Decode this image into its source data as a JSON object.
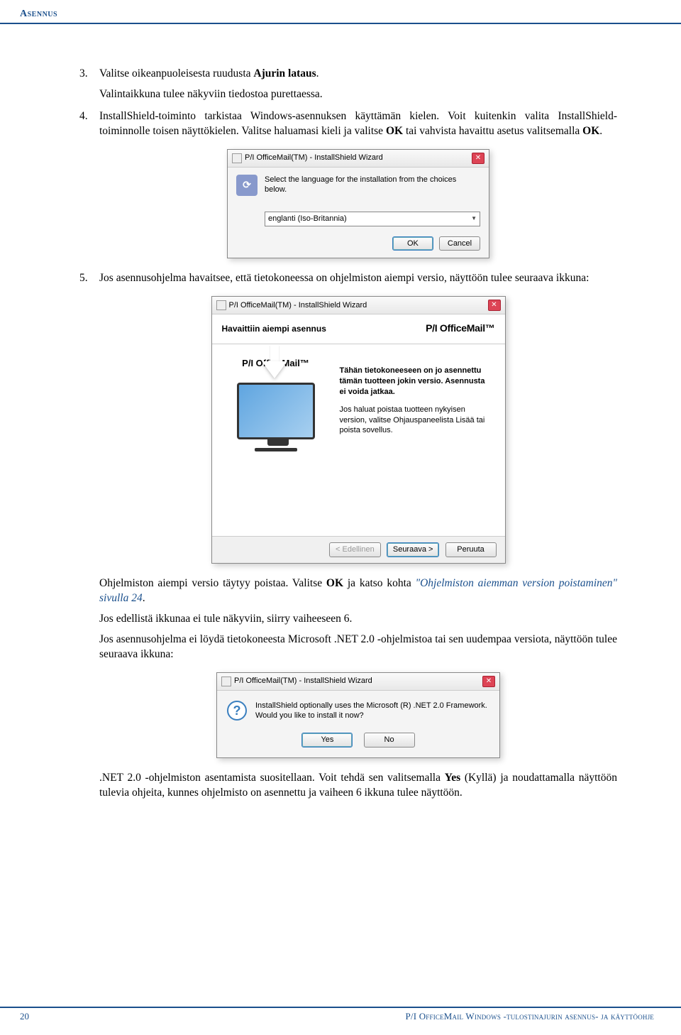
{
  "header": {
    "section_label": "Asennus"
  },
  "steps": {
    "s3": {
      "num": "3.",
      "text_a": "Valitse oikeanpuoleisesta ruudusta ",
      "bold_a": "Ajurin lataus",
      "text_b": ".",
      "para2": "Valintaikkuna tulee näkyviin tiedostoa purettaessa."
    },
    "s4": {
      "num": "4.",
      "line1": "InstallShield-toiminto tarkistaa Windows-asennuksen käyttämän kielen. Voit kuitenkin valita InstallShield-toiminnolle toisen näyttökielen. Valitse haluamasi kieli ja valitse ",
      "bold1": "OK",
      "line1b": " tai vahvista havaittu asetus valitsemalla ",
      "bold2": "OK",
      "line1c": "."
    },
    "s5": {
      "num": "5.",
      "line1": "Jos asennusohjelma havaitsee, että tietokoneessa on ohjelmiston aiempi versio, näyttöön tulee seuraava ikkuna:",
      "after1a": "Ohjelmiston aiempi versio täytyy poistaa. Valitse ",
      "after1_bold": "OK",
      "after1b": " ja katso kohta ",
      "after1_link": "\"Ohjelmiston aiemman version poistaminen\" sivulla 24",
      "after1c": ".",
      "after2": "Jos edellistä ikkunaa ei tule näkyviin, siirry vaiheeseen 6.",
      "after3": "Jos asennusohjelma ei löydä tietokoneesta Microsoft .NET 2.0 -ohjelmistoa tai sen uudempaa versiota, näyttöön tulee seuraava ikkuna:",
      "after4a": ".NET 2.0 -ohjelmiston asentamista suositellaan. Voit tehdä sen valitsemalla ",
      "after4_bold": "Yes",
      "after4b": " (Kyllä) ja noudattamalla näyttöön tulevia ohjeita, kunnes ohjelmisto on asennettu ja vaiheen 6 ikkuna tulee näyttöön."
    }
  },
  "dlg1": {
    "title": "P/I OfficeMail(TM) - InstallShield Wizard",
    "msg": "Select the language for the installation from the choices below.",
    "select_value": "englanti (Iso-Britannia)",
    "ok": "OK",
    "cancel": "Cancel"
  },
  "dlg2": {
    "title": "P/I OfficeMail(TM) - InstallShield Wizard",
    "heading": "Havaittiin aiempi asennus",
    "brand": "P/I OfficeMail™",
    "brand_left": "P/I OfficeMail™",
    "msg1": "Tähän tietokoneeseen on jo asennettu tämän tuotteen jokin versio. Asennusta ei voida jatkaa.",
    "msg2": "Jos haluat poistaa tuotteen nykyisen version, valitse Ohjauspaneelista Lisää tai poista sovellus.",
    "back": "< Edellinen",
    "next": "Seuraava >",
    "cancel": "Peruuta"
  },
  "dlg3": {
    "title": "P/I OfficeMail(TM) - InstallShield Wizard",
    "msg_l1": "InstallShield optionally uses the Microsoft (R) .NET 2.0 Framework.",
    "msg_l2": "Would you like to install it now?",
    "yes": "Yes",
    "no": "No"
  },
  "footer": {
    "page_num": "20",
    "doc_title": "P/I OfficeMail Windows -tulostinajurin asennus- ja käyttöohje"
  }
}
